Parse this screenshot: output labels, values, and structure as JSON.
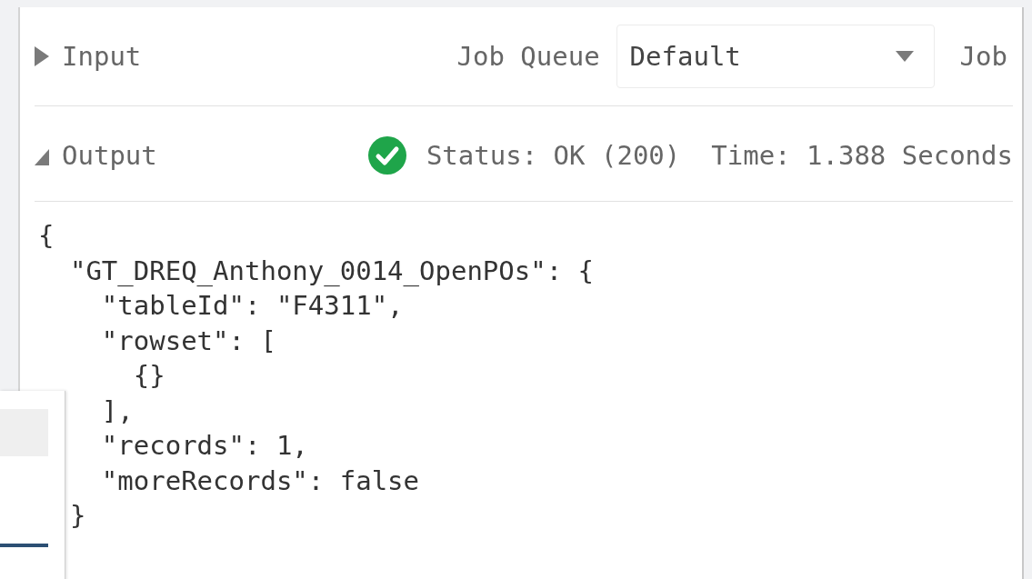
{
  "input_section": {
    "title": "Input",
    "expanded": false,
    "job_queue": {
      "label": "Job Queue",
      "value": "Default"
    },
    "column_3": "Job"
  },
  "output_section": {
    "title": "Output",
    "expanded": true,
    "status": "Status: OK (200)",
    "time": "Time: 1.388 Seconds",
    "response": "{\n  \"GT_DREQ_Anthony_0014_OpenPOs\": {\n    \"tableId\": \"F4311\",\n    \"rowset\": [\n      {}\n    ],\n    \"records\": 1,\n    \"moreRecords\": false\n  }"
  }
}
